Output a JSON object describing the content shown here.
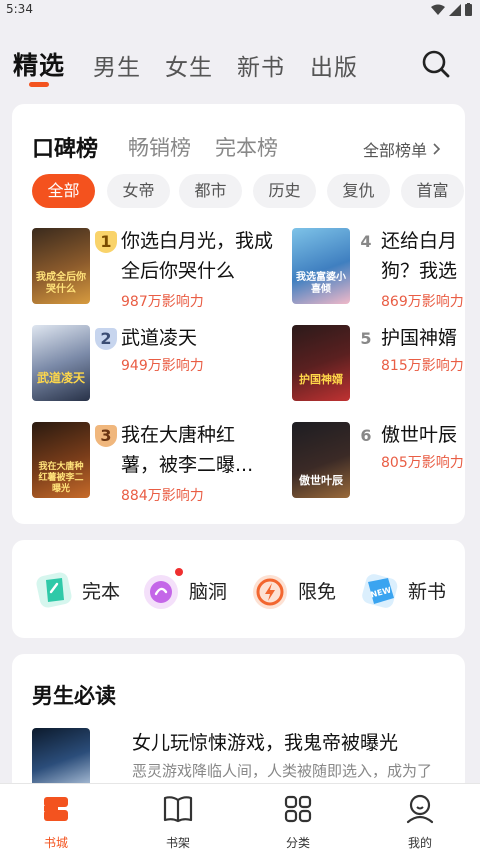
{
  "status": {
    "time": "5:34"
  },
  "top_tabs": [
    "精选",
    "男生",
    "女生",
    "新书",
    "出版"
  ],
  "ranking": {
    "tabs": [
      "口碑榜",
      "畅销榜",
      "完本榜"
    ],
    "all_label": "全部榜单",
    "chips": [
      "全部",
      "女帝",
      "都市",
      "历史",
      "复仇",
      "首富"
    ],
    "books": [
      {
        "rank": "1",
        "title": "你选白月光，我成全后你哭什么",
        "popularity": "987万影响力",
        "cover_text": "我成全后你哭什么"
      },
      {
        "rank": "2",
        "title": "武道凌天",
        "popularity": "949万影响力",
        "cover_text": "武道凌天"
      },
      {
        "rank": "3",
        "title": "我在大唐种红薯，被李二曝...",
        "popularity": "884万影响力",
        "cover_text": "我在大唐种红薯被李二曝光"
      },
      {
        "rank": "4",
        "title": "还给白月狗？我选",
        "popularity": "869万影响力",
        "cover_text": "我选富婆小喜倾"
      },
      {
        "rank": "5",
        "title": "护国神婿",
        "popularity": "815万影响力",
        "cover_text": "护国神婿"
      },
      {
        "rank": "6",
        "title": "傲世叶辰",
        "popularity": "805万影响力",
        "cover_text": "傲世叶辰"
      }
    ]
  },
  "quick_entries": [
    {
      "label": "完本",
      "icon": "book-complete-icon",
      "color": "#2fc9a8"
    },
    {
      "label": "脑洞",
      "icon": "brain-idea-icon",
      "color": "#b55be0"
    },
    {
      "label": "限免",
      "icon": "lightning-free-icon",
      "color": "#f2662f"
    },
    {
      "label": "新书",
      "icon": "new-tag-icon",
      "color": "#3aa4f0"
    }
  ],
  "must_read": {
    "title": "男生必读",
    "book_title": "女儿玩惊悚游戏，我鬼帝被曝光",
    "book_desc": "恶灵游戏降临人间，人类被随即选入，成为了"
  },
  "bottom_nav": [
    {
      "label": "书城",
      "icon": "bookstore-icon"
    },
    {
      "label": "书架",
      "icon": "bookshelf-icon"
    },
    {
      "label": "分类",
      "icon": "category-grid-icon"
    },
    {
      "label": "我的",
      "icon": "profile-icon"
    }
  ],
  "colors": {
    "accent": "#f3531f",
    "popularity": "#e95d44"
  }
}
